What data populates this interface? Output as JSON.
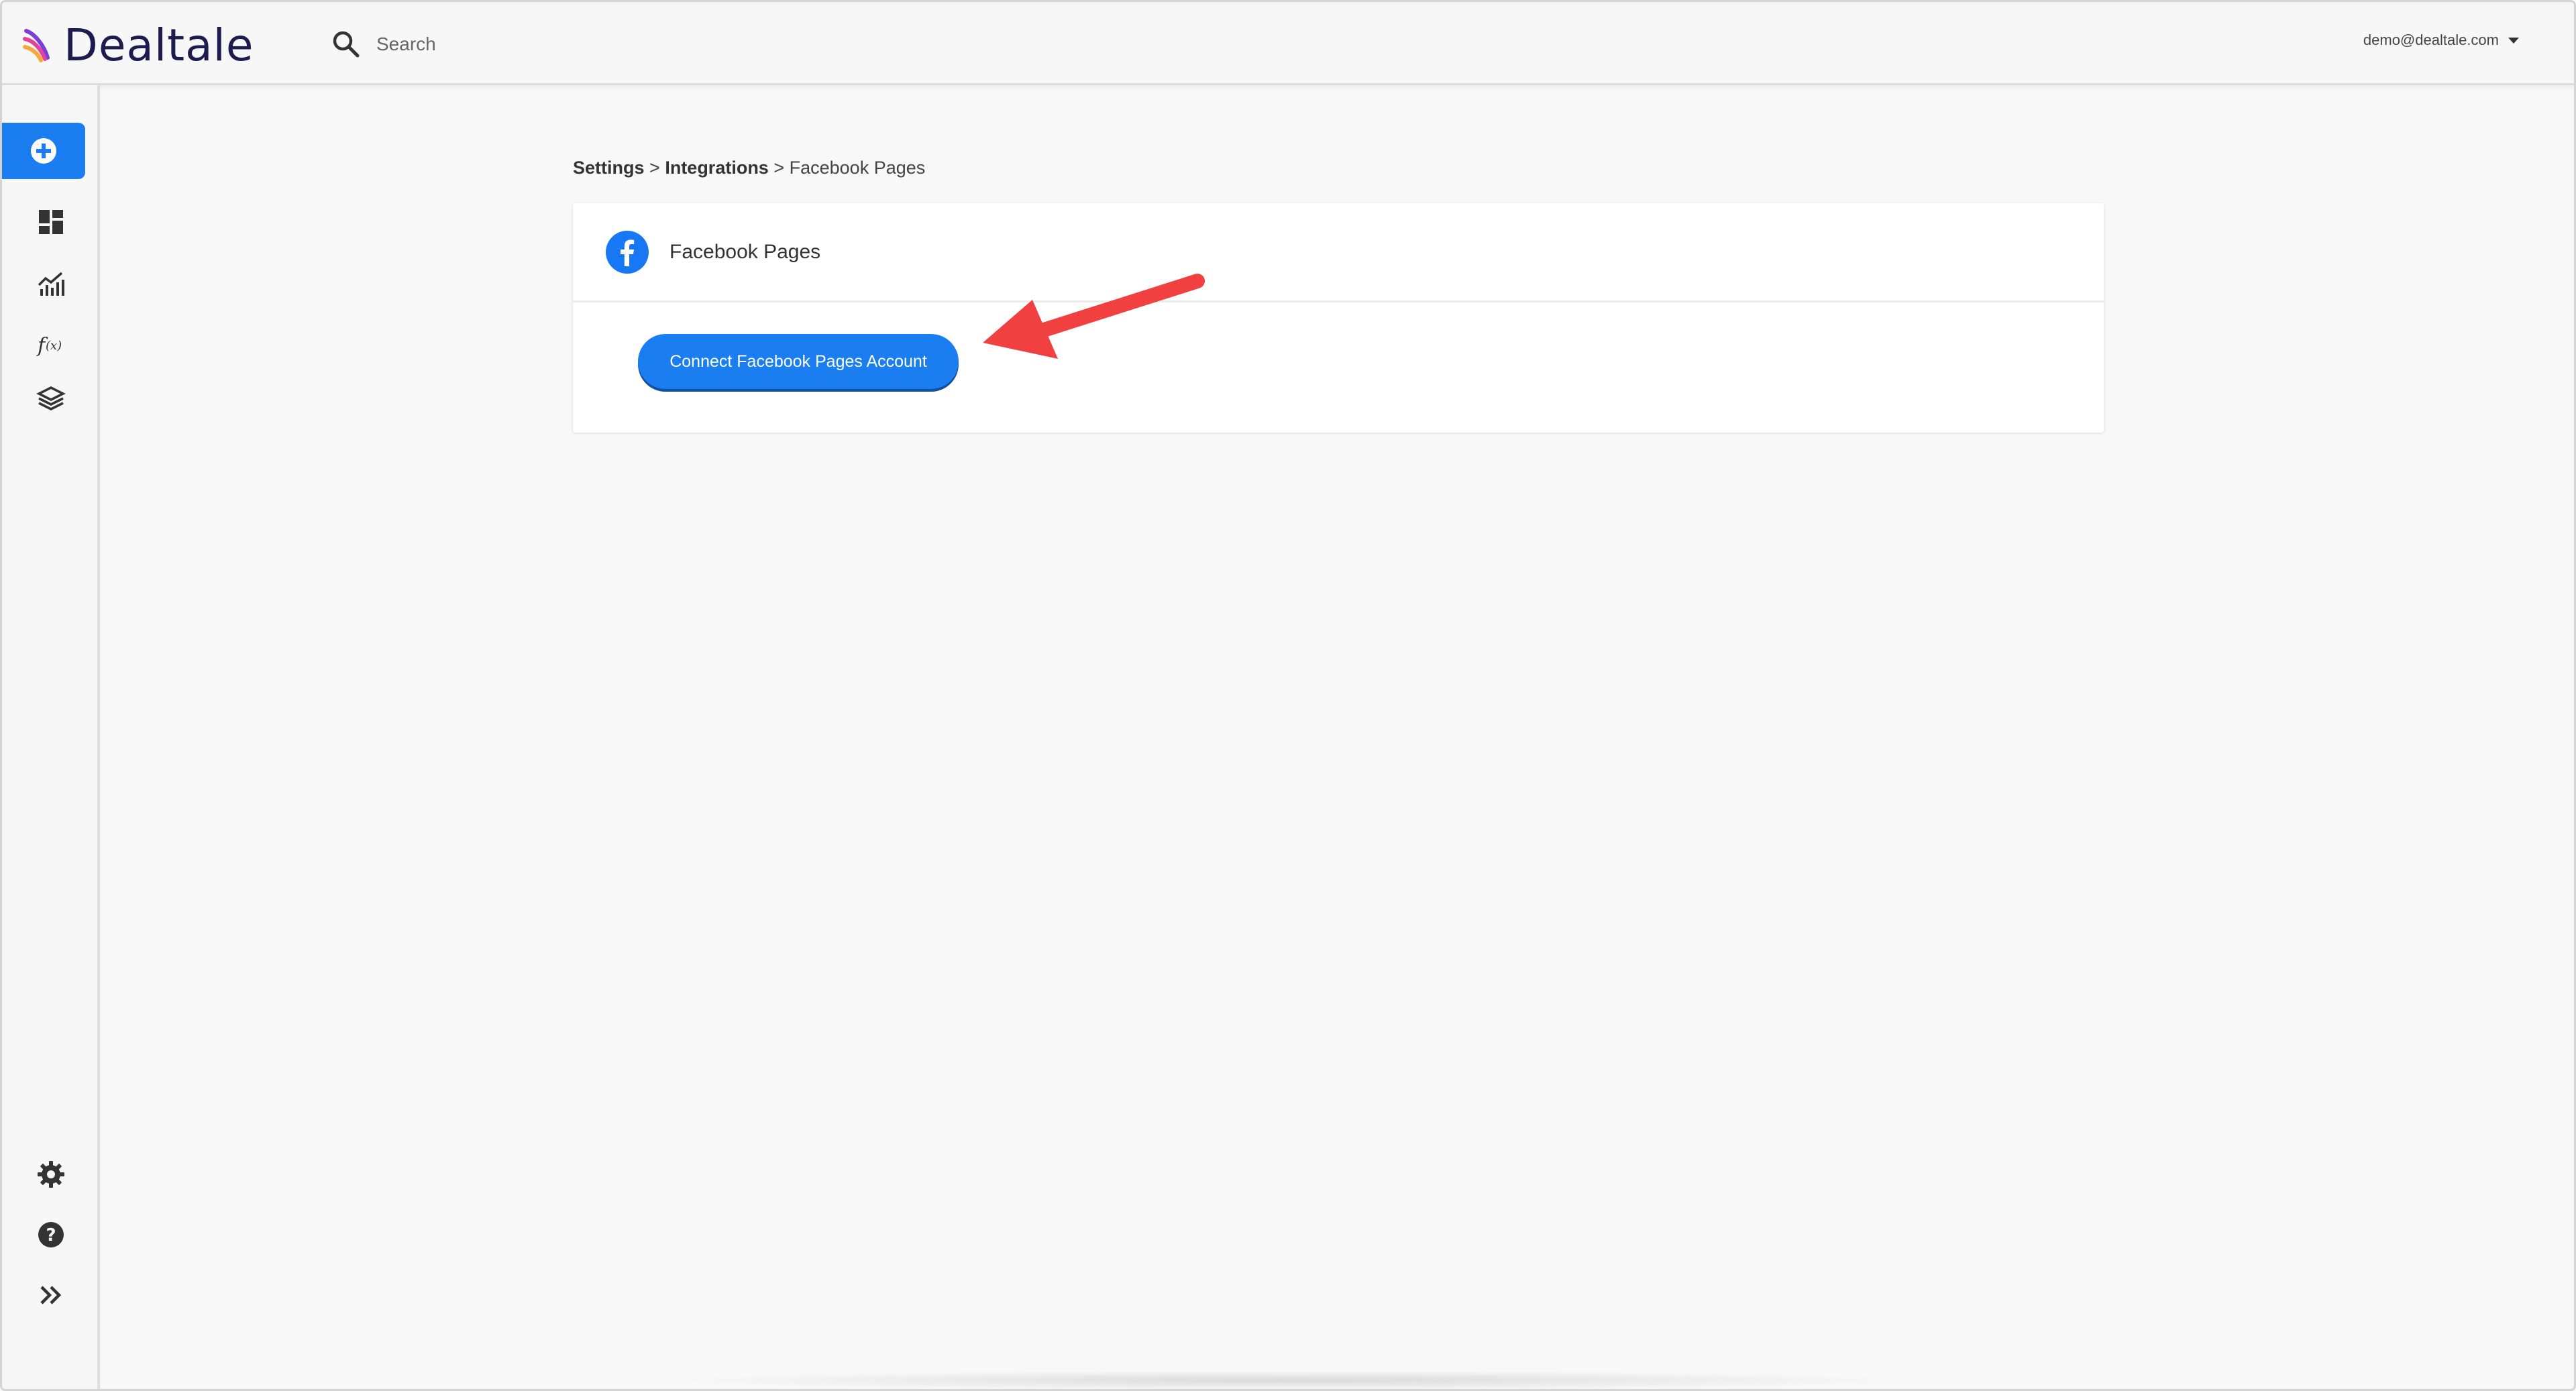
{
  "brand": {
    "name": "Dealtale"
  },
  "search": {
    "placeholder": "Search"
  },
  "user": {
    "email": "demo@dealtale.com"
  },
  "sidebar": {
    "items": [
      {
        "icon": "plus-circle-icon",
        "label": "New"
      },
      {
        "icon": "dashboard-icon",
        "label": "Dashboards"
      },
      {
        "icon": "analytics-chart-icon",
        "label": "Analytics"
      },
      {
        "icon": "function-icon",
        "label": "Formulas"
      },
      {
        "icon": "layers-icon",
        "label": "Layers"
      }
    ],
    "bottom_items": [
      {
        "icon": "gear-icon",
        "label": "Settings"
      },
      {
        "icon": "help-icon",
        "label": "Help"
      },
      {
        "icon": "expand-chevrons-icon",
        "label": "Expand"
      }
    ]
  },
  "breadcrumb": {
    "items": [
      "Settings",
      "Integrations",
      "Facebook Pages"
    ],
    "separator": ">"
  },
  "card": {
    "title": "Facebook Pages",
    "button_label": "Connect Facebook Pages Account"
  },
  "colors": {
    "accent": "#1a7ef0",
    "facebook": "#1877f2",
    "annotation": "#f04040"
  }
}
